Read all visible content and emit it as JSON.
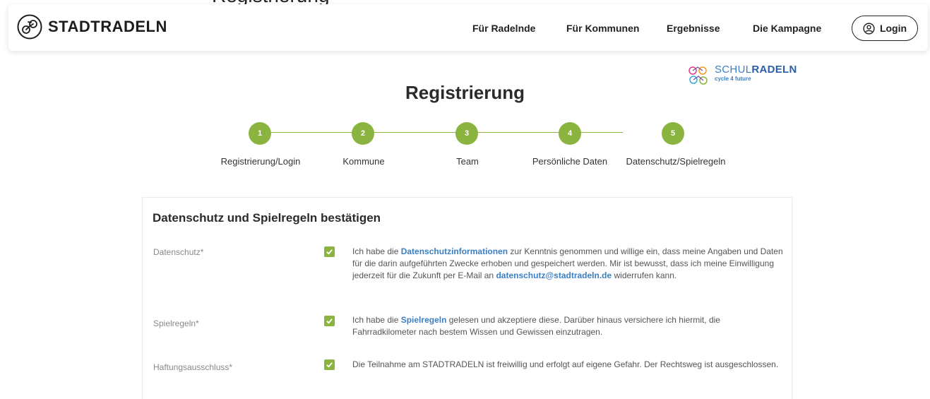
{
  "nav": {
    "brand": "STADTRADELN",
    "items": [
      "Für Radelnde",
      "Für Kommunen",
      "Ergebnisse",
      "Die Kampagne"
    ],
    "login": "Login"
  },
  "partner_logo": {
    "main_light": "SCHUL",
    "main_bold": "RADELN",
    "sub": "cycle 4 future"
  },
  "page_title": "Registrierung",
  "steps": [
    {
      "number": "1",
      "label": "Registrierung/Login"
    },
    {
      "number": "2",
      "label": "Kommune"
    },
    {
      "number": "3",
      "label": "Team"
    },
    {
      "number": "4",
      "label": "Persönliche Daten"
    },
    {
      "number": "5",
      "label": "Datenschutz/Spielregeln"
    }
  ],
  "consent": {
    "title": "Datenschutz und Spielregeln bestätigen",
    "rows": [
      {
        "label": "Datenschutz*",
        "checked": true,
        "text_before": "Ich habe die ",
        "link1": "Datenschutzinformationen",
        "text_middle": " zur Kenntnis genommen und willige ein, dass meine Angaben und Daten für die darin aufgeführten Zwecke erhoben und gespeichert werden. Mir ist bewusst, dass ich meine Einwilligung jederzeit für die Zukunft per E-Mail an ",
        "link2": "datenschutz@stadtradeln.de",
        "text_after": " widerrufen kann."
      },
      {
        "label": "Spielregeln*",
        "checked": true,
        "text_before": "Ich habe die ",
        "link1": "Spielregeln",
        "text_after": " gelesen und akzeptiere diese. Darüber hinaus versichere ich hiermit, die Fahrradkilometer nach bestem Wissen und Gewissen einzutragen."
      },
      {
        "label": "Haftungsausschluss*",
        "checked": true,
        "text": "Die Teilnahme am STADTRADELN ist freiwillig und erfolgt auf eigene Gefahr. Der Rechtsweg ist ausgeschlossen."
      }
    ]
  },
  "colors": {
    "accent_green": "#8bb33f",
    "link_blue": "#3b7fc4"
  }
}
